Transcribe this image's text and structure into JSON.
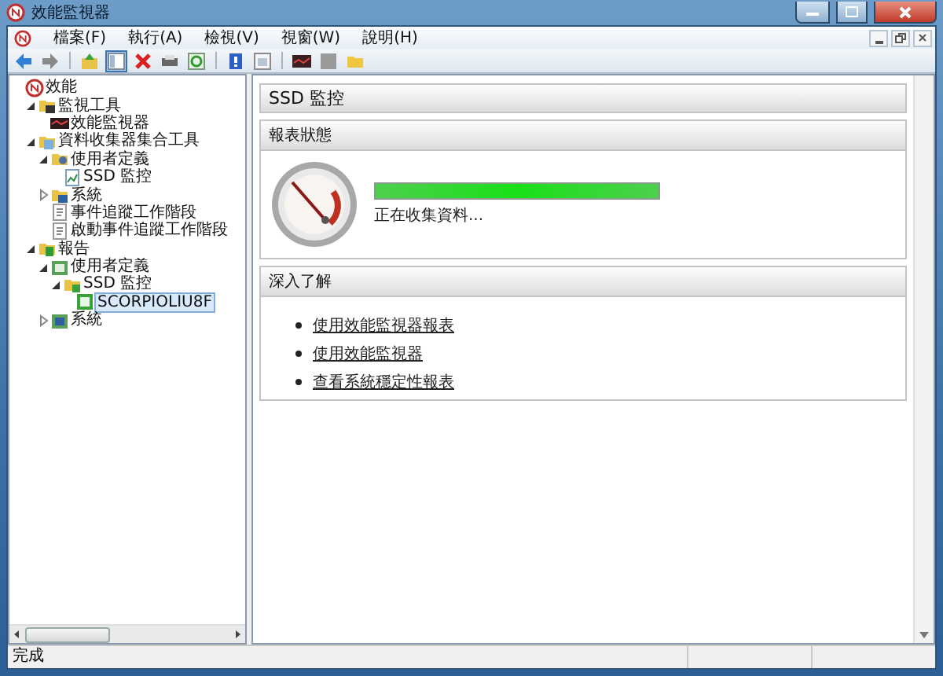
{
  "window": {
    "title": "效能監視器"
  },
  "menu": [
    "檔案(F)",
    "執行(A)",
    "檢視(V)",
    "視窗(W)",
    "說明(H)"
  ],
  "toolbar": [
    {
      "kind": "back",
      "selected": false
    },
    {
      "kind": "forward",
      "selected": false
    },
    {
      "kind": "separator"
    },
    {
      "kind": "up",
      "selected": false
    },
    {
      "kind": "pane",
      "selected": true
    },
    {
      "kind": "delete",
      "selected": false
    },
    {
      "kind": "print",
      "selected": false
    },
    {
      "kind": "refresh",
      "selected": false
    },
    {
      "kind": "separator"
    },
    {
      "kind": "help",
      "selected": false
    },
    {
      "kind": "properties",
      "selected": false
    },
    {
      "kind": "separator"
    },
    {
      "kind": "monitor",
      "selected": false
    },
    {
      "kind": "stop",
      "selected": false
    },
    {
      "kind": "folder",
      "selected": false
    }
  ],
  "tree": [
    {
      "label": "效能",
      "kind": "root",
      "selected": false,
      "children": [
        {
          "label": "監視工具",
          "kind": "tools",
          "expanded": true,
          "selected": false,
          "children": [
            {
              "label": "效能監視器",
              "kind": "monitor",
              "selected": false
            }
          ]
        },
        {
          "label": "資料收集器集合工具",
          "kind": "collector",
          "expanded": true,
          "selected": false,
          "children": [
            {
              "label": "使用者定義",
              "kind": "user",
              "expanded": true,
              "selected": false,
              "children": [
                {
                  "label": "SSD 監控",
                  "kind": "set",
                  "selected": false
                }
              ]
            },
            {
              "label": "系統",
              "kind": "system",
              "expanded": false,
              "selected": false
            },
            {
              "label": "事件追蹤工作階段",
              "kind": "log",
              "selected": false
            },
            {
              "label": "啟動事件追蹤工作階段",
              "kind": "log",
              "selected": false
            }
          ]
        },
        {
          "label": "報告",
          "kind": "report",
          "expanded": true,
          "selected": false,
          "children": [
            {
              "label": "使用者定義",
              "kind": "report-user",
              "expanded": true,
              "selected": false,
              "children": [
                {
                  "label": "SSD 監控",
                  "kind": "report-folder",
                  "expanded": true,
                  "selected": false,
                  "children": [
                    {
                      "label": "SCORPIOLIU8F",
                      "kind": "report-item",
                      "selected": true
                    }
                  ]
                }
              ]
            },
            {
              "label": "系統",
              "kind": "report-system",
              "expanded": false,
              "selected": false
            }
          ]
        }
      ]
    }
  ],
  "header": {
    "title": "SSD 監控"
  },
  "report_status": {
    "title": "報表狀態",
    "level": 1,
    "message": "正在收集資料..."
  },
  "learn_more": {
    "title": "深入了解",
    "links": [
      "使用效能監視器報表",
      "使用效能監視器",
      "查看系統穩定性報表"
    ]
  },
  "status_bar": {
    "text": "完成"
  }
}
